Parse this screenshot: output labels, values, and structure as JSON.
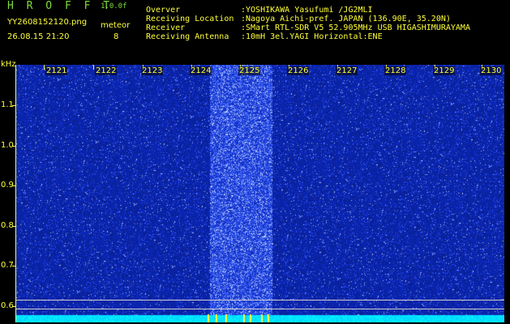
{
  "header": {
    "logo": "H R O F F T",
    "version": "1.0.0f",
    "filename": "YY2608152120.png",
    "datetime": "26.08.15 21:20",
    "meteor_label": "meteor",
    "meteor_count": "8",
    "info": [
      {
        "label": "Overver",
        "value": ":YOSHIKAWA Yasufumi /JG2MLI"
      },
      {
        "label": "Receiving Location",
        "value": ":Nagoya Aichi-pref. JAPAN (136.90E, 35.20N)"
      },
      {
        "label": "Receiver",
        "value": ":SMart RTL-SDR V5 52.905MHz USB HIGASHIMURAYAMA"
      },
      {
        "label": "Receiving Antenna",
        "value": ":10mH 3el.YAGI Horizontal:ENE"
      }
    ]
  },
  "spectrogram": {
    "y_unit": "kHz",
    "x_ticks": [
      "2121",
      "2122",
      "2123",
      "2124",
      "2125",
      "2126",
      "2127",
      "2128",
      "2129",
      "2130"
    ],
    "y_ticks": [
      "1.1",
      "1.0",
      "0.9",
      "0.8",
      "0.7",
      "0.6"
    ],
    "colors": {
      "background": "#000000",
      "noise": "#1a2fd0",
      "bright": "#7fb0ff",
      "baseline": "#00e5ff",
      "accent": "#ffff3a"
    }
  }
}
